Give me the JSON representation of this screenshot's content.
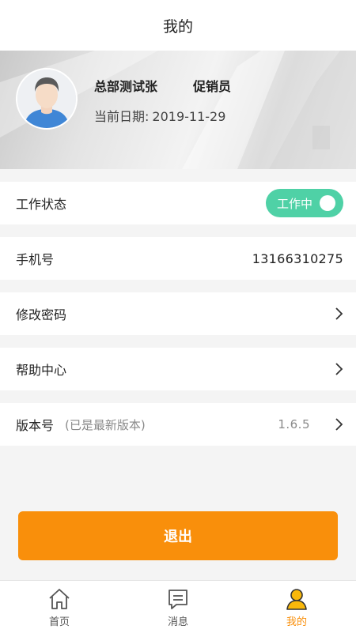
{
  "header": {
    "title": "我的"
  },
  "profile": {
    "name": "总部测试张",
    "role": "促销员",
    "date_label": "当前日期:",
    "date_value": "2019-11-29"
  },
  "settings": {
    "work_status": {
      "label": "工作状态",
      "toggle_text": "工作中",
      "on": true
    },
    "phone": {
      "label": "手机号",
      "value": "13166310275"
    },
    "change_password": {
      "label": "修改密码"
    },
    "help_center": {
      "label": "帮助中心"
    },
    "version": {
      "label": "版本号",
      "note": "(已是最新版本)",
      "value": "1.6.5"
    }
  },
  "logout_label": "退出",
  "tabbar": {
    "items": [
      {
        "label": "首页",
        "icon": "home-icon",
        "active": false
      },
      {
        "label": "消息",
        "icon": "message-icon",
        "active": false
      },
      {
        "label": "我的",
        "icon": "user-icon",
        "active": true
      }
    ]
  },
  "colors": {
    "accent": "#f98f0b",
    "toggle_on": "#4fd1a6",
    "page_bg": "#f4f4f4"
  }
}
